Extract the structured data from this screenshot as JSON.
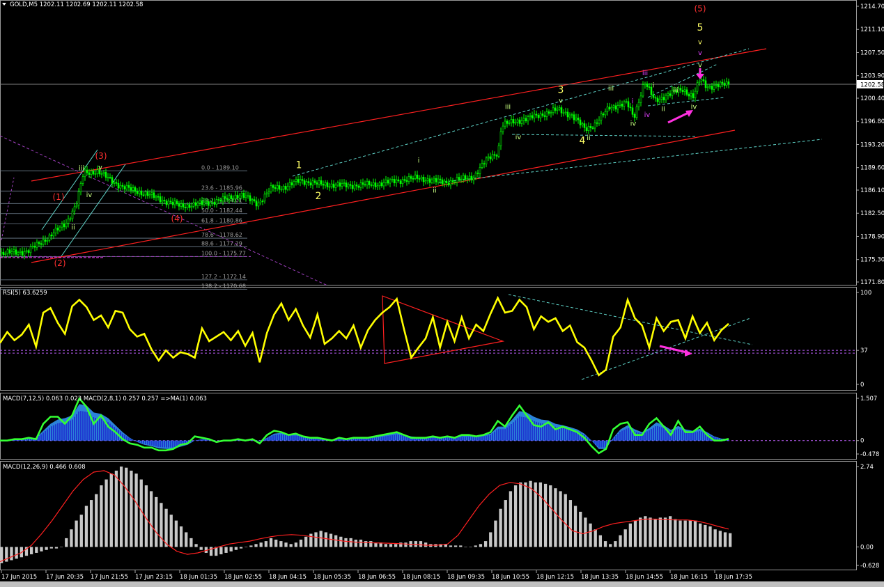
{
  "window": {
    "symbol_header": "GOLD,M5  1202.11 1202.69 1202.11 1202.58"
  },
  "colors": {
    "background": "#000000",
    "candle": "#00ff00",
    "trend_channel": "#ff2020",
    "dashed_channel": "#5fd3c8",
    "fib_line": "#708090",
    "fib_dashed": "#a040c0",
    "wave_red": "#ff3030",
    "wave_yellow": "#ffff66",
    "wave_label_green": "#c8ff80",
    "wave_label_violet": "#e040ff",
    "arrow_magenta": "#ff30e0",
    "rsi_line": "#ffff00",
    "macd_fast_line": "#33ff33",
    "macd_fill": "#1a1acc",
    "macd_fill_light": "#3399ff",
    "hist_bar": "#c8c8c8",
    "signal_line": "#ff2020"
  },
  "chart_data": [
    {
      "type": "candlestick",
      "title": "GOLD,M5",
      "ohlc_last": {
        "open": 1202.11,
        "high": 1202.69,
        "low": 1202.11,
        "close": 1202.58
      },
      "current_price_label": "1202.58",
      "ylim": [
        1171.8,
        1214.7
      ],
      "y_ticks": [
        "1214.70",
        "1211.10",
        "1207.50",
        "1203.90",
        "1200.40",
        "1196.80",
        "1193.20",
        "1189.60",
        "1186.10",
        "1182.50",
        "1178.90",
        "1175.30",
        "1171.80"
      ],
      "price_path": [
        [
          0,
          1176.2
        ],
        [
          40,
          1176.6
        ],
        [
          70,
          1178.8
        ],
        [
          95,
          1181.0
        ],
        [
          110,
          1184.0
        ],
        [
          120,
          1188.8
        ],
        [
          140,
          1189.0
        ],
        [
          150,
          1188.3
        ],
        [
          175,
          1186.6
        ],
        [
          210,
          1185.5
        ],
        [
          240,
          1184.3
        ],
        [
          260,
          1183.6
        ],
        [
          290,
          1184.0
        ],
        [
          320,
          1184.6
        ],
        [
          345,
          1185.4
        ],
        [
          370,
          1184.0
        ],
        [
          390,
          1186.4
        ],
        [
          410,
          1186.6
        ],
        [
          430,
          1187.6
        ],
        [
          460,
          1187.0
        ],
        [
          500,
          1186.8
        ],
        [
          540,
          1187.0
        ],
        [
          560,
          1187.4
        ],
        [
          600,
          1188.0
        ],
        [
          620,
          1187.6
        ],
        [
          640,
          1187.3
        ],
        [
          680,
          1188.2
        ],
        [
          700,
          1191.0
        ],
        [
          715,
          1192.0
        ],
        [
          720,
          1196.2
        ],
        [
          740,
          1196.8
        ],
        [
          770,
          1197.6
        ],
        [
          800,
          1198.6
        ],
        [
          820,
          1197.8
        ],
        [
          840,
          1195.6
        ],
        [
          855,
          1196.4
        ],
        [
          875,
          1199.0
        ],
        [
          900,
          1199.6
        ],
        [
          910,
          1197.4
        ],
        [
          925,
          1203.0
        ],
        [
          940,
          1200.0
        ],
        [
          960,
          1201.0
        ],
        [
          980,
          1201.8
        ],
        [
          995,
          1200.6
        ],
        [
          1005,
          1203.4
        ],
        [
          1015,
          1202.2
        ],
        [
          1030,
          1202.4
        ],
        [
          1046,
          1202.6
        ]
      ],
      "fib_levels": [
        {
          "label": "0.0 - 1189.10",
          "value": 1189.1
        },
        {
          "label": "23.6 - 1185.96",
          "value": 1185.96
        },
        {
          "label": "38.2 - 1184.01",
          "value": 1184.01
        },
        {
          "label": "50.0 - 1182.44",
          "value": 1182.44
        },
        {
          "label": "61.8 - 1180.86",
          "value": 1180.86
        },
        {
          "label": "78.6 - 1178.62",
          "value": 1178.62
        },
        {
          "label": "88.6 - 1177.29",
          "value": 1177.29
        },
        {
          "label": "100.0 - 1175.77",
          "value": 1175.77
        },
        {
          "label": "127.2 - 1172.14",
          "value": 1172.14
        },
        {
          "label": "138.2 - 1170.68",
          "value": 1170.68
        }
      ],
      "wave_labels": [
        {
          "text": "(5)",
          "x": 1005,
          "price": 1213.9,
          "color": "#ff3030"
        },
        {
          "text": "5",
          "x": 1005,
          "price": 1210.9,
          "color": "#ffff66"
        },
        {
          "text": "v",
          "x": 1005,
          "price": 1208.8,
          "color": "#ffff66"
        },
        {
          "text": "v",
          "x": 1005,
          "price": 1207.1,
          "color": "#e040ff"
        },
        {
          "text": "v",
          "x": 1005,
          "price": 1205.2,
          "color": "#c8ff80"
        },
        {
          "text": "iii",
          "x": 926,
          "price": 1204.0,
          "color": "#e040ff"
        },
        {
          "text": "iii",
          "x": 877,
          "price": 1201.6,
          "color": "#c8ff80"
        },
        {
          "text": "i",
          "x": 938,
          "price": 1202.1,
          "color": "#c8ff80"
        },
        {
          "text": "iii",
          "x": 970,
          "price": 1201.3,
          "color": "#c8ff80"
        },
        {
          "text": "3",
          "x": 805,
          "price": 1201.2,
          "color": "#ffff66"
        },
        {
          "text": "v",
          "x": 805,
          "price": 1199.7,
          "color": "#c8ff80"
        },
        {
          "text": "i",
          "x": 908,
          "price": 1199.6,
          "color": "#e040ff"
        },
        {
          "text": "ii",
          "x": 952,
          "price": 1198.4,
          "color": "#c8ff80"
        },
        {
          "text": "iv",
          "x": 996,
          "price": 1198.7,
          "color": "#c8ff80"
        },
        {
          "text": "iv",
          "x": 929,
          "price": 1197.5,
          "color": "#e040ff"
        },
        {
          "text": "iii",
          "x": 729,
          "price": 1198.7,
          "color": "#c8ff80"
        },
        {
          "text": "iv",
          "x": 909,
          "price": 1196.1,
          "color": "#c8ff80"
        },
        {
          "text": "iv",
          "x": 744,
          "price": 1194.0,
          "color": "#c8ff80"
        },
        {
          "text": "4",
          "x": 836,
          "price": 1193.3,
          "color": "#ffff66"
        },
        {
          "text": "ii",
          "x": 845,
          "price": 1193.9,
          "color": "#c8ff80"
        },
        {
          "text": "i",
          "x": 601,
          "price": 1190.4,
          "color": "#c8ff80"
        },
        {
          "text": "ii",
          "x": 624,
          "price": 1185.7,
          "color": "#c8ff80"
        },
        {
          "text": "1",
          "x": 429,
          "price": 1189.5,
          "color": "#ffff66"
        },
        {
          "text": "2",
          "x": 457,
          "price": 1184.7,
          "color": "#ffff66"
        },
        {
          "text": "(3)",
          "x": 145,
          "price": 1191.0,
          "color": "#ff3030"
        },
        {
          "text": "iii",
          "x": 117,
          "price": 1189.2,
          "color": "#c8ff80"
        },
        {
          "text": "v",
          "x": 144,
          "price": 1189.3,
          "color": "#c8ff80"
        },
        {
          "text": "iv",
          "x": 128,
          "price": 1185.0,
          "color": "#c8ff80"
        },
        {
          "text": "(1)",
          "x": 84,
          "price": 1184.6,
          "color": "#ff3030"
        },
        {
          "text": "ii",
          "x": 105,
          "price": 1180.0,
          "color": "#c8ff80"
        },
        {
          "text": "(4)",
          "x": 254,
          "price": 1181.2,
          "color": "#ff3030"
        },
        {
          "text": "(2)",
          "x": 86,
          "price": 1174.3,
          "color": "#ff3030"
        }
      ]
    },
    {
      "type": "line",
      "title": "RSI(5) 63.6259",
      "ylim": [
        0,
        100
      ],
      "y_ticks": [
        "100",
        "37",
        "0"
      ],
      "level": 37,
      "values": [
        45,
        57,
        48,
        54,
        65,
        41,
        78,
        83,
        67,
        55,
        85,
        92,
        84,
        70,
        75,
        62,
        80,
        78,
        60,
        52,
        55,
        38,
        26,
        37,
        29,
        35,
        33,
        29,
        61,
        47,
        52,
        57,
        48,
        58,
        42,
        56,
        24,
        56,
        76,
        88,
        70,
        82,
        64,
        51,
        76,
        44,
        50,
        58,
        50,
        64,
        40,
        59,
        70,
        78,
        84,
        93,
        60,
        29,
        40,
        50,
        73,
        40,
        68,
        47,
        73,
        50,
        65,
        58,
        77,
        94,
        78,
        80,
        92,
        84,
        60,
        74,
        68,
        72,
        58,
        64,
        46,
        40,
        26,
        10,
        16,
        52,
        62,
        92,
        72,
        64,
        40,
        72,
        58,
        68,
        70,
        50,
        74,
        56,
        67,
        48,
        59,
        66
      ],
      "current_value": 63.6259
    },
    {
      "type": "area",
      "title": "MACD(7,12,5) 0.063 0.023  MACD(2,8,1) 0.257 0.257  =>MA(1) 0.063",
      "ylim": [
        -0.478,
        1.507
      ],
      "y_ticks": [
        "1.507",
        "0",
        "-0.478"
      ],
      "fast_values": [
        0.0,
        0.0,
        0.05,
        0.05,
        0.1,
        0.05,
        0.6,
        0.85,
        0.85,
        0.6,
        0.9,
        1.5,
        1.2,
        0.6,
        0.9,
        0.5,
        0.3,
        0.05,
        -0.1,
        -0.15,
        -0.25,
        -0.25,
        -0.35,
        -0.35,
        -0.3,
        -0.15,
        -0.1,
        0.15,
        0.1,
        0.05,
        -0.05,
        0.0,
        0.0,
        0.05,
        0.0,
        0.05,
        -0.1,
        0.2,
        0.35,
        0.3,
        0.2,
        0.25,
        0.15,
        0.1,
        0.1,
        0.05,
        0.0,
        0.1,
        0.05,
        0.1,
        0.1,
        0.1,
        0.15,
        0.2,
        0.25,
        0.3,
        0.2,
        0.1,
        0.1,
        0.1,
        0.15,
        0.1,
        0.15,
        0.1,
        0.2,
        0.2,
        0.15,
        0.2,
        0.3,
        0.7,
        0.5,
        0.9,
        1.25,
        0.9,
        0.55,
        0.5,
        0.65,
        0.4,
        0.5,
        0.4,
        0.3,
        0.1,
        -0.2,
        -0.45,
        -0.3,
        0.4,
        0.6,
        0.65,
        0.2,
        0.2,
        0.6,
        0.8,
        0.5,
        0.2,
        0.7,
        0.3,
        0.3,
        0.5,
        0.2,
        0.0,
        0.0,
        0.06
      ],
      "fill_values": [
        0.0,
        0.0,
        0.04,
        0.05,
        0.08,
        0.1,
        0.35,
        0.6,
        0.75,
        0.8,
        0.9,
        1.3,
        1.25,
        1.0,
        0.95,
        0.8,
        0.55,
        0.3,
        0.1,
        -0.05,
        -0.15,
        -0.2,
        -0.28,
        -0.3,
        -0.3,
        -0.22,
        -0.15,
        0.0,
        0.05,
        0.05,
        0.0,
        0.0,
        0.0,
        0.02,
        0.0,
        0.02,
        -0.03,
        0.1,
        0.25,
        0.28,
        0.22,
        0.22,
        0.18,
        0.12,
        0.1,
        0.08,
        0.04,
        0.07,
        0.06,
        0.08,
        0.09,
        0.1,
        0.13,
        0.17,
        0.22,
        0.27,
        0.22,
        0.15,
        0.12,
        0.1,
        0.12,
        0.11,
        0.13,
        0.12,
        0.16,
        0.18,
        0.17,
        0.19,
        0.25,
        0.5,
        0.5,
        0.75,
        1.05,
        1.0,
        0.85,
        0.75,
        0.72,
        0.6,
        0.55,
        0.48,
        0.4,
        0.25,
        0.0,
        -0.3,
        -0.3,
        0.1,
        0.4,
        0.55,
        0.4,
        0.3,
        0.45,
        0.65,
        0.55,
        0.38,
        0.52,
        0.4,
        0.35,
        0.42,
        0.3,
        0.15,
        0.07,
        0.06
      ]
    },
    {
      "type": "bar",
      "title": "MACD(12,26,9) 0.466 0.608",
      "ylim": [
        -0.628,
        2.74
      ],
      "y_ticks": [
        "2.74",
        "0.00",
        "-0.628"
      ],
      "histogram": [
        -0.55,
        -0.5,
        -0.45,
        -0.4,
        -0.35,
        -0.3,
        -0.25,
        -0.2,
        -0.15,
        -0.1,
        -0.05,
        -0.05,
        0.0,
        0.3,
        0.6,
        0.9,
        1.1,
        1.4,
        1.6,
        1.8,
        2.1,
        2.3,
        2.5,
        2.6,
        2.74,
        2.7,
        2.6,
        2.5,
        2.3,
        2.1,
        1.9,
        1.7,
        1.5,
        1.3,
        1.1,
        0.9,
        0.7,
        0.5,
        0.3,
        0.1,
        -0.1,
        -0.2,
        -0.3,
        -0.3,
        -0.25,
        -0.2,
        -0.15,
        -0.1,
        -0.05,
        0.0,
        0.05,
        0.1,
        0.15,
        0.2,
        0.3,
        0.25,
        0.2,
        0.15,
        0.1,
        0.15,
        0.25,
        0.35,
        0.45,
        0.5,
        0.55,
        0.5,
        0.45,
        0.4,
        0.35,
        0.3,
        0.3,
        0.25,
        0.25,
        0.2,
        0.2,
        0.15,
        0.15,
        0.1,
        0.1,
        0.1,
        0.15,
        0.15,
        0.2,
        0.2,
        0.2,
        0.15,
        0.1,
        0.1,
        0.1,
        0.1,
        0.05,
        0.05,
        0.05,
        0.0,
        0.0,
        0.05,
        0.1,
        0.2,
        0.5,
        0.9,
        1.3,
        1.6,
        1.9,
        2.1,
        2.2,
        2.2,
        2.25,
        2.2,
        2.2,
        2.15,
        2.1,
        2.0,
        1.9,
        1.8,
        1.6,
        1.4,
        1.2,
        1.0,
        0.8,
        0.6,
        0.4,
        0.2,
        0.1,
        0.2,
        0.4,
        0.6,
        0.8,
        0.9,
        1.0,
        1.05,
        1.0,
        0.95,
        1.0,
        1.0,
        1.05,
        0.95,
        0.9,
        0.9,
        0.9,
        0.9,
        0.8,
        0.75,
        0.7,
        0.6,
        0.55,
        0.5,
        0.47
      ],
      "signal": [
        -0.5,
        -0.35,
        -0.2,
        0.05,
        0.45,
        0.9,
        1.4,
        1.9,
        2.3,
        2.55,
        2.6,
        2.45,
        2.05,
        1.55,
        1.0,
        0.5,
        0.1,
        -0.15,
        -0.25,
        -0.2,
        -0.1,
        0.0,
        0.1,
        0.15,
        0.2,
        0.28,
        0.35,
        0.4,
        0.42,
        0.4,
        0.35,
        0.3,
        0.25,
        0.2,
        0.17,
        0.15,
        0.14,
        0.13,
        0.12,
        0.1,
        0.08,
        0.06,
        0.06,
        0.1,
        0.4,
        0.9,
        1.4,
        1.8,
        2.1,
        2.2,
        2.15,
        2.0,
        1.7,
        1.3,
        0.9,
        0.55,
        0.45,
        0.55,
        0.7,
        0.8,
        0.85,
        0.9,
        0.95,
        0.95,
        0.93,
        0.92,
        0.92,
        0.88,
        0.8,
        0.7,
        0.61
      ]
    }
  ],
  "time_axis": {
    "labels": [
      "17 Jun 2015",
      "17 Jun 20:35",
      "17 Jun 21:55",
      "17 Jun 23:15",
      "18 Jun 01:35",
      "18 Jun 02:55",
      "18 Jun 04:15",
      "18 Jun 05:35",
      "18 Jun 06:55",
      "18 Jun 08:15",
      "18 Jun 09:35",
      "18 Jun 10:55",
      "18 Jun 12:15",
      "18 Jun 13:35",
      "18 Jun 14:55",
      "18 Jun 16:15",
      "18 Jun 17:35"
    ]
  }
}
